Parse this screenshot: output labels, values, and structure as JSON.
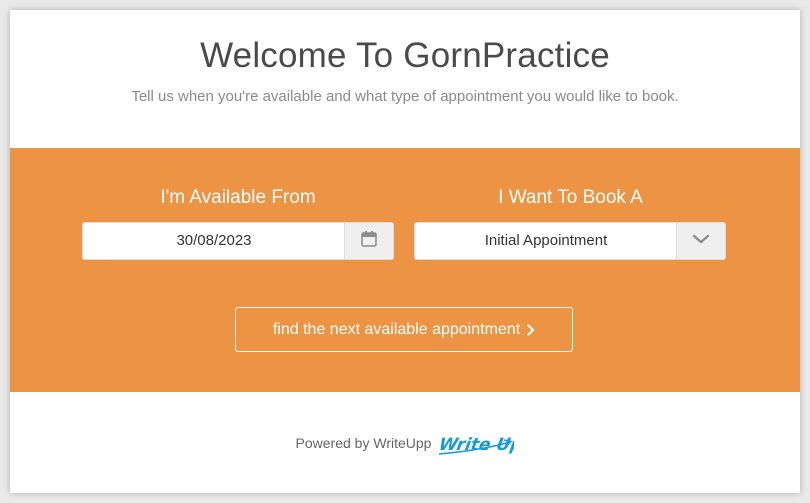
{
  "header": {
    "title": "Welcome To GornPractice",
    "subtitle": "Tell us when you're available and what type of appointment you would like to book."
  },
  "form": {
    "available_from_label": "I'm Available From",
    "available_from_value": "30/08/2023",
    "book_label": "I Want To Book A",
    "appointment_type_value": "Initial Appointment",
    "find_button_label": "find the next available appointment"
  },
  "footer": {
    "powered_by": "Powered by WriteUpp",
    "logo_text": "Write Upp"
  },
  "colors": {
    "band": "#ed9444",
    "logo": "#1a9ad6"
  },
  "icons": {
    "date_addon": "calendar-icon",
    "select_addon": "chevron-down-icon",
    "button": "chevron-right-icon"
  }
}
